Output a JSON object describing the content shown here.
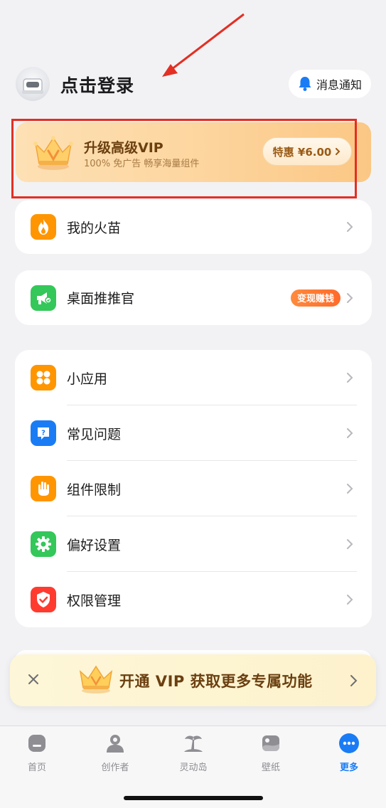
{
  "header": {
    "login_text": "点击登录",
    "notify_label": "消息通知"
  },
  "vip_card": {
    "title": "升级高级VIP",
    "subtitle": "100% 免广告  畅享海量组件",
    "offer": "特惠 ¥6.00"
  },
  "menu_groups": [
    {
      "items": [
        {
          "label": "我的火苗",
          "icon": "flame-icon",
          "color": "#ff9500"
        }
      ]
    },
    {
      "items": [
        {
          "label": "桌面推推官",
          "icon": "megaphone-icon",
          "color": "#34c759",
          "badge": "变现赚钱"
        }
      ]
    },
    {
      "items": [
        {
          "label": "小应用",
          "icon": "apps-grid-icon",
          "color": "#ff9500"
        },
        {
          "label": "常见问题",
          "icon": "question-bubble-icon",
          "color": "#1a7cf5"
        },
        {
          "label": "组件限制",
          "icon": "hand-stop-icon",
          "color": "#ff9500"
        },
        {
          "label": "偏好设置",
          "icon": "gear-icon",
          "color": "#34c759"
        },
        {
          "label": "权限管理",
          "icon": "shield-check-icon",
          "color": "#ff3b30"
        }
      ]
    }
  ],
  "promo": {
    "text": "开通 VIP 获取更多专属功能"
  },
  "tabbar": {
    "tabs": [
      {
        "label": "首页",
        "icon": "home-icon"
      },
      {
        "label": "创作者",
        "icon": "creator-icon"
      },
      {
        "label": "灵动岛",
        "icon": "island-palm-icon"
      },
      {
        "label": "壁纸",
        "icon": "wallpaper-icon"
      },
      {
        "label": "更多",
        "icon": "more-icon",
        "active": true
      }
    ]
  },
  "colors": {
    "accent_blue": "#1a7cf5",
    "vip_gold": "#fbc784",
    "badge_orange": "#ff7a33",
    "annotation_red": "#e32f24"
  }
}
